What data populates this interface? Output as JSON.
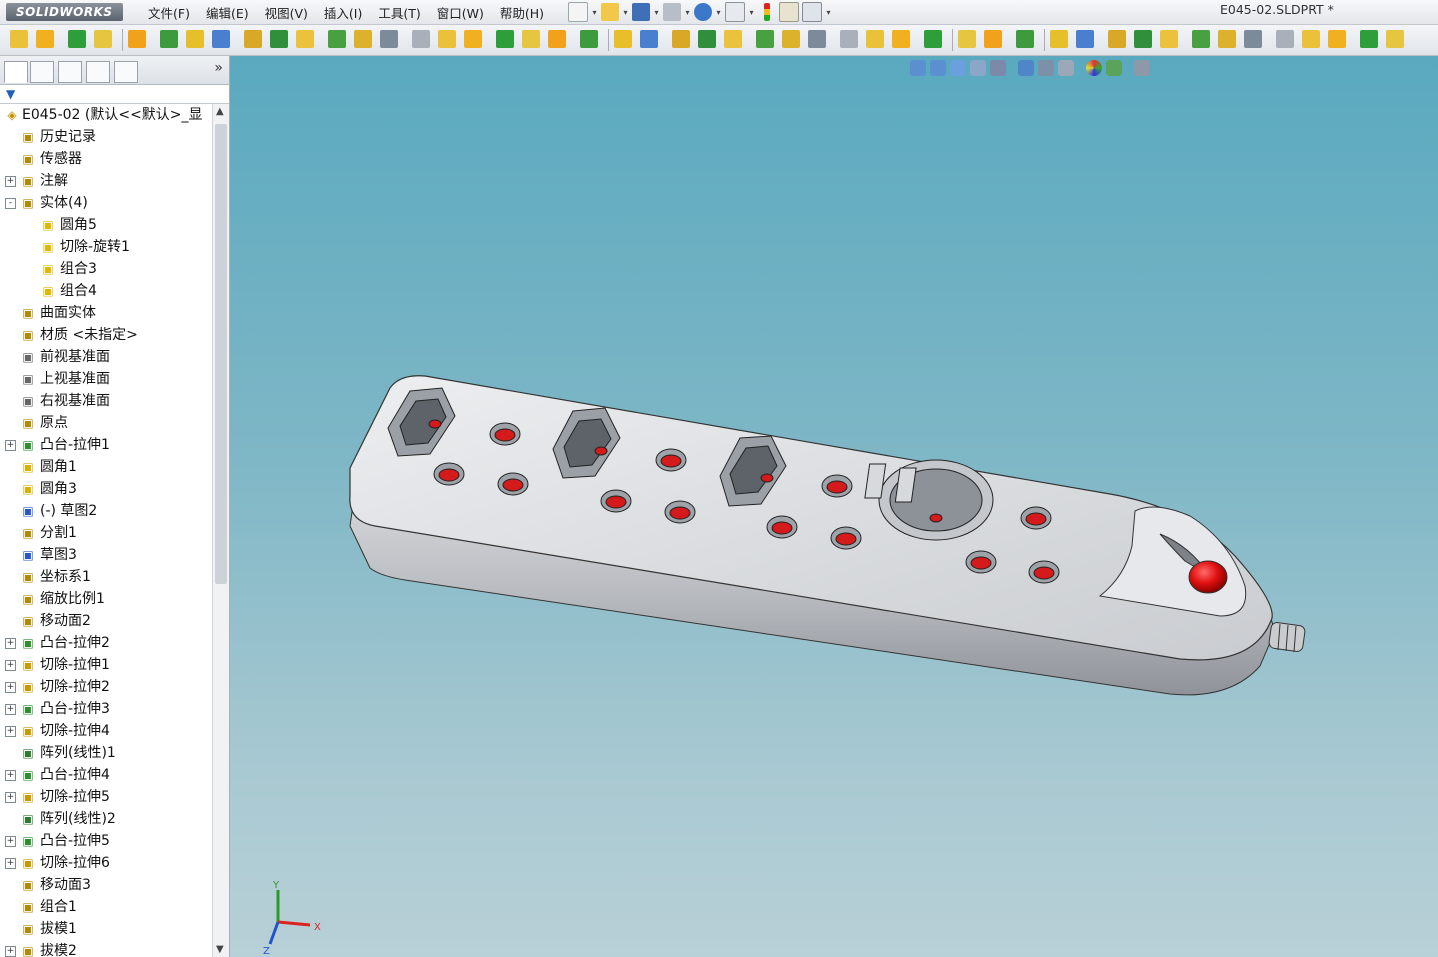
{
  "app": {
    "logo": "SOLIDWORKS",
    "document_title": "E045-02.SLDPRT *"
  },
  "menu": [
    "文件(F)",
    "编辑(E)",
    "视图(V)",
    "插入(I)",
    "工具(T)",
    "窗口(W)",
    "帮助(H)"
  ],
  "tree": {
    "root_label": "E045-02  (默认<<默认>_显",
    "items": [
      {
        "label": "历史记录",
        "icon": "history-icon",
        "expand": false
      },
      {
        "label": "传感器",
        "icon": "sensor-icon",
        "expand": false
      },
      {
        "label": "注解",
        "icon": "annotation-icon",
        "expand": true,
        "state": "+"
      },
      {
        "label": "实体(4)",
        "icon": "solid-bodies-folder-icon",
        "expand": true,
        "state": "-"
      },
      {
        "label": "圆角5",
        "icon": "body-icon",
        "child": true
      },
      {
        "label": "切除-旋转1",
        "icon": "body-icon",
        "child": true
      },
      {
        "label": "组合3",
        "icon": "body-icon",
        "child": true
      },
      {
        "label": "组合4",
        "icon": "body-icon",
        "child": true
      },
      {
        "label": "曲面实体",
        "icon": "surface-bodies-icon",
        "expand": false
      },
      {
        "label": "材质 <未指定>",
        "icon": "material-icon",
        "expand": false
      },
      {
        "label": "前视基准面",
        "icon": "plane-icon",
        "expand": false
      },
      {
        "label": "上视基准面",
        "icon": "plane-icon",
        "expand": false
      },
      {
        "label": "右视基准面",
        "icon": "plane-icon",
        "expand": false
      },
      {
        "label": "原点",
        "icon": "origin-icon",
        "expand": false
      },
      {
        "label": "凸台-拉伸1",
        "icon": "boss-extrude-icon",
        "expand": true,
        "state": "+"
      },
      {
        "label": "圆角1",
        "icon": "fillet-icon",
        "expand": false
      },
      {
        "label": "圆角3",
        "icon": "fillet-icon",
        "expand": false
      },
      {
        "label": "(-) 草图2",
        "icon": "sketch-icon",
        "expand": false
      },
      {
        "label": "分割1",
        "icon": "split-icon",
        "expand": false
      },
      {
        "label": "草图3",
        "icon": "sketch-icon",
        "expand": false
      },
      {
        "label": "坐标系1",
        "icon": "coordinate-system-icon",
        "expand": false
      },
      {
        "label": "缩放比例1",
        "icon": "scale-icon",
        "expand": false
      },
      {
        "label": "移动面2",
        "icon": "move-face-icon",
        "expand": false
      },
      {
        "label": "凸台-拉伸2",
        "icon": "boss-extrude-icon",
        "expand": true,
        "state": "+"
      },
      {
        "label": "切除-拉伸1",
        "icon": "cut-extrude-icon",
        "expand": true,
        "state": "+"
      },
      {
        "label": "切除-拉伸2",
        "icon": "cut-extrude-icon",
        "expand": true,
        "state": "+"
      },
      {
        "label": "凸台-拉伸3",
        "icon": "boss-extrude-icon",
        "expand": true,
        "state": "+"
      },
      {
        "label": "切除-拉伸4",
        "icon": "cut-extrude-icon",
        "expand": true,
        "state": "+"
      },
      {
        "label": "阵列(线性)1",
        "icon": "linear-pattern-icon",
        "expand": false
      },
      {
        "label": "凸台-拉伸4",
        "icon": "boss-extrude-icon",
        "expand": true,
        "state": "+"
      },
      {
        "label": "切除-拉伸5",
        "icon": "cut-extrude-icon",
        "expand": true,
        "state": "+"
      },
      {
        "label": "阵列(线性)2",
        "icon": "linear-pattern-icon",
        "expand": false
      },
      {
        "label": "凸台-拉伸5",
        "icon": "boss-extrude-icon",
        "expand": true,
        "state": "+"
      },
      {
        "label": "切除-拉伸6",
        "icon": "cut-extrude-icon",
        "expand": true,
        "state": "+"
      },
      {
        "label": "移动面3",
        "icon": "move-face-icon",
        "expand": false
      },
      {
        "label": "组合1",
        "icon": "combine-icon",
        "expand": false
      },
      {
        "label": "拔模1",
        "icon": "draft-icon",
        "expand": false
      },
      {
        "label": "拔模2",
        "icon": "draft-icon",
        "expand": true,
        "state": "+"
      }
    ]
  },
  "triad": {
    "x": "X",
    "y": "Y",
    "z": "Z"
  },
  "colors": {
    "viewport_top": "#5aa9bf",
    "viewport_bottom": "#b8d0d7",
    "socket_red": "#d41a1a",
    "body_gray": "#c8cacd"
  }
}
